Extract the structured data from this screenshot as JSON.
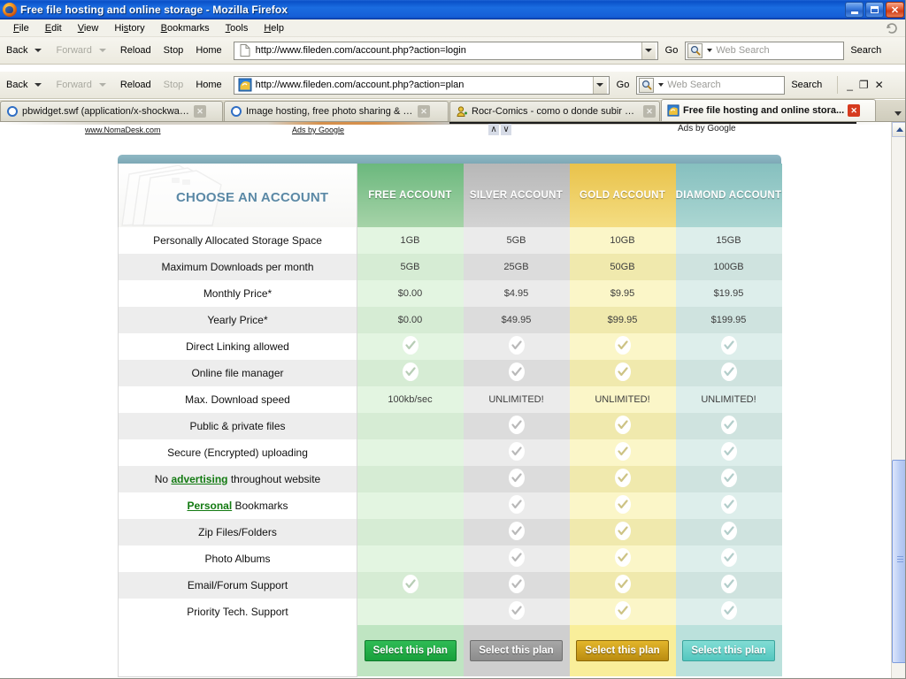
{
  "window": {
    "title": "Free file hosting and online storage - Mozilla Firefox",
    "minimize_label": "Minimize",
    "maximize_label": "Maximize",
    "close_label": "Close"
  },
  "menu": {
    "items": [
      {
        "label": "File"
      },
      {
        "label": "Edit"
      },
      {
        "label": "View"
      },
      {
        "label": "History"
      },
      {
        "label": "Bookmarks"
      },
      {
        "label": "Tools"
      },
      {
        "label": "Help"
      }
    ]
  },
  "toolbar1": {
    "back": "Back",
    "forward": "Forward",
    "reload": "Reload",
    "stop": "Stop",
    "home": "Home",
    "url": "http://www.fileden.com/account.php?action=login",
    "go": "Go",
    "search_placeholder": "Web Search",
    "search_button": "Search"
  },
  "toolbar2": {
    "back": "Back",
    "forward": "Forward",
    "reload": "Reload",
    "stop": "Stop",
    "home": "Home",
    "url": "http://www.fileden.com/account.php?action=plan",
    "go": "Go",
    "search_placeholder": "Web Search",
    "search_button": "Search",
    "minimize": "_",
    "restore": "❐",
    "close": "✕"
  },
  "tabs": [
    {
      "label": "pbwidget.swf (application/x-shockwav...",
      "active": false,
      "close": "✕"
    },
    {
      "label": "Image hosting, free photo sharing & v...",
      "active": false,
      "close": "✕"
    },
    {
      "label": "Rocr-Comics - como o donde subir ani...",
      "active": false,
      "close": "✕"
    },
    {
      "label": "Free file hosting and online stora...",
      "active": true,
      "close": "✕"
    }
  ],
  "ads": {
    "noma_link": "www.NomaDesk.com",
    "google_left": "Ads by Google",
    "google_right": "Ads by Google",
    "arrow_up": "∧",
    "arrow_down": "∨"
  },
  "plan_table": {
    "brand_title": "CHOOSE AN ACCOUNT",
    "columns": [
      {
        "key": "free",
        "label": "FREE ACCOUNT",
        "color": "#6bb87d"
      },
      {
        "key": "silver",
        "label": "SILVER ACCOUNT",
        "color": "#b7b7b7"
      },
      {
        "key": "gold",
        "label": "GOLD ACCOUNT",
        "color": "#e9c24a"
      },
      {
        "key": "diamond",
        "label": "DIAMOND ACCOUNT",
        "color": "#86c0bf"
      }
    ],
    "rows": [
      {
        "label": "Personally Allocated Storage Space",
        "values": [
          "1GB",
          "5GB",
          "10GB",
          "15GB"
        ]
      },
      {
        "label": "Maximum Downloads per month",
        "values": [
          "5GB",
          "25GB",
          "50GB",
          "100GB"
        ]
      },
      {
        "label": "Monthly Price*",
        "values": [
          "$0.00",
          "$4.95",
          "$9.95",
          "$19.95"
        ]
      },
      {
        "label": "Yearly Price*",
        "values": [
          "$0.00",
          "$49.95",
          "$99.95",
          "$199.95"
        ]
      },
      {
        "label": "Direct Linking allowed",
        "values": [
          "check",
          "check",
          "check",
          "check"
        ]
      },
      {
        "label": "Online file manager",
        "values": [
          "check",
          "check",
          "check",
          "check"
        ]
      },
      {
        "label": "Max. Download speed",
        "values": [
          "100kb/sec",
          "UNLIMITED!",
          "UNLIMITED!",
          "UNLIMITED!"
        ]
      },
      {
        "label": "Public & private files",
        "values": [
          "",
          "check",
          "check",
          "check"
        ]
      },
      {
        "label": "Secure (Encrypted) uploading",
        "values": [
          "",
          "check",
          "check",
          "check"
        ]
      },
      {
        "label": "No advertising throughout website",
        "link": "advertising",
        "values": [
          "",
          "check",
          "check",
          "check"
        ]
      },
      {
        "label": "Personal Bookmarks",
        "link": "Personal",
        "values": [
          "",
          "check",
          "check",
          "check"
        ]
      },
      {
        "label": "Zip Files/Folders",
        "values": [
          "",
          "check",
          "check",
          "check"
        ]
      },
      {
        "label": "Photo Albums",
        "values": [
          "",
          "check",
          "check",
          "check"
        ]
      },
      {
        "label": "Email/Forum Support",
        "values": [
          "check",
          "check",
          "check",
          "check"
        ]
      },
      {
        "label": "Priority Tech. Support",
        "values": [
          "",
          "check",
          "check",
          "check"
        ]
      }
    ],
    "select_button_label": "Select this plan"
  },
  "scrollbar": {
    "up_arrow": "▲"
  }
}
